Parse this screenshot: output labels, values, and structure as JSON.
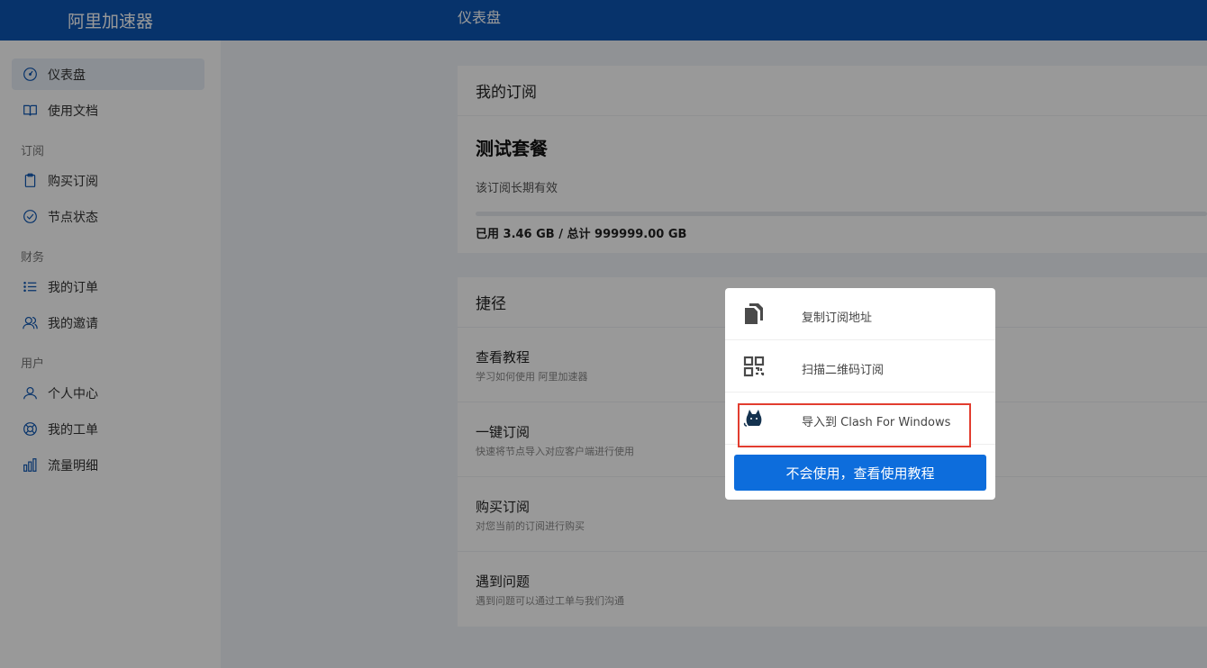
{
  "app": {
    "brand": "阿里加速器",
    "page_title": "仪表盘"
  },
  "sidebar": {
    "items_top": [
      {
        "label": "仪表盘",
        "icon": "dashboard-icon",
        "active": true
      },
      {
        "label": "使用文档",
        "icon": "book-icon"
      }
    ],
    "groups": [
      {
        "title": "订阅",
        "items": [
          {
            "label": "购买订阅",
            "icon": "clipboard-icon"
          },
          {
            "label": "节点状态",
            "icon": "check-circle-icon"
          }
        ]
      },
      {
        "title": "财务",
        "items": [
          {
            "label": "我的订单",
            "icon": "list-icon"
          },
          {
            "label": "我的邀请",
            "icon": "users-icon"
          }
        ]
      },
      {
        "title": "用户",
        "items": [
          {
            "label": "个人中心",
            "icon": "user-icon"
          },
          {
            "label": "我的工单",
            "icon": "lifebuoy-icon"
          },
          {
            "label": "流量明细",
            "icon": "bar-chart-icon"
          }
        ]
      }
    ]
  },
  "subscription": {
    "header": "我的订阅",
    "plan_name": "测试套餐",
    "plan_desc": "该订阅长期有效",
    "usage_text": "已用 3.46 GB / 总计 999999.00 GB",
    "usage_fraction": 3.5e-06
  },
  "shortcuts": {
    "header": "捷径",
    "items": [
      {
        "title": "查看教程",
        "desc": "学习如何使用 阿里加速器"
      },
      {
        "title": "一键订阅",
        "desc": "快速将节点导入对应客户端进行使用"
      },
      {
        "title": "购买订阅",
        "desc": "对您当前的订阅进行购买"
      },
      {
        "title": "遇到问题",
        "desc": "遇到问题可以通过工单与我们沟通"
      }
    ]
  },
  "popup": {
    "options": [
      {
        "label": "复制订阅地址",
        "icon": "copy-icon"
      },
      {
        "label": "扫描二维码订阅",
        "icon": "qrcode-icon"
      },
      {
        "label": "导入到 Clash For Windows",
        "icon": "clash-cat-icon",
        "highlighted": true
      }
    ],
    "button": "不会使用，查看使用教程"
  },
  "colors": {
    "primary": "#0d56b2",
    "button": "#0d6ddc",
    "highlight": "#e23d2f"
  }
}
